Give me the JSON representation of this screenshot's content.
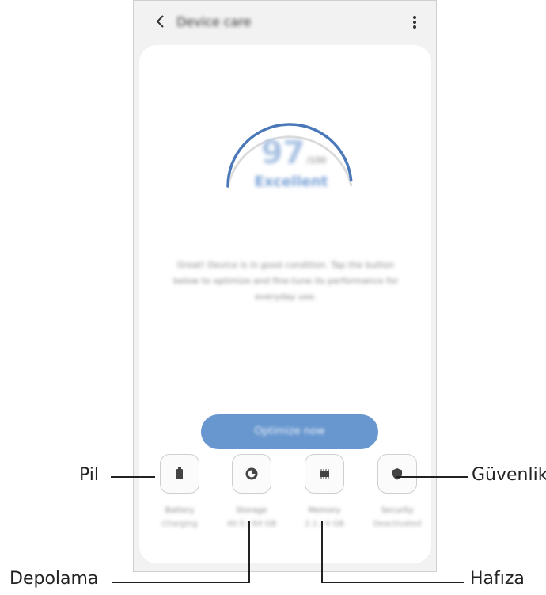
{
  "app": {
    "title": "Device care",
    "back_icon": "‹",
    "more_icon": "⋮"
  },
  "score": {
    "value": "97",
    "unit": "/100",
    "status": "Excellent",
    "level": 0.97
  },
  "description": "Great! Device is in good condition. Tap the button below to optimize and fine-tune its performance for everyday use.",
  "optimize_button": "Optimize now",
  "tiles": [
    {
      "name": "battery",
      "label": "Battery",
      "value": "Charging",
      "icon": "battery-icon"
    },
    {
      "name": "storage",
      "label": "Storage",
      "value": "40.5 / 64 GB",
      "icon": "storage-icon"
    },
    {
      "name": "memory",
      "label": "Memory",
      "value": "2.1 / 4 GB",
      "icon": "memory-icon"
    },
    {
      "name": "security",
      "label": "Security",
      "value": "Deactivated",
      "icon": "security-icon"
    }
  ],
  "callouts": {
    "pil": "Pil",
    "depolama": "Depolama",
    "hafiza": "Hafıza",
    "guvenlik": "Güvenlik"
  },
  "colors": {
    "accent": "#6897cf",
    "gauge": "#4b78b8",
    "gauge_track": "#dcdcdc"
  }
}
